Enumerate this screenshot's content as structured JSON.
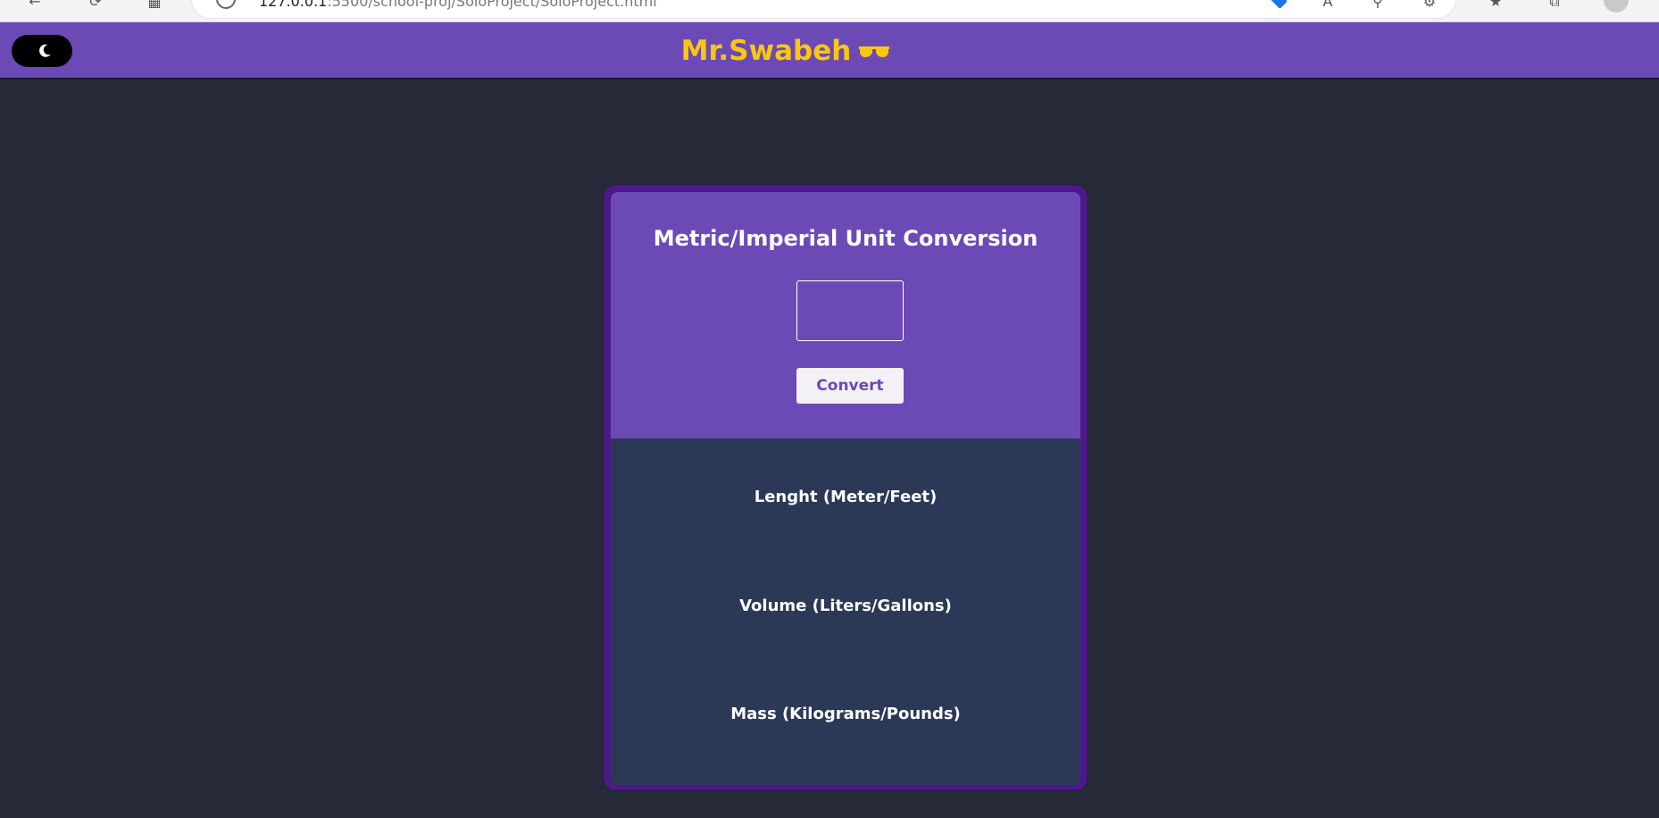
{
  "browser": {
    "address_host": "127.0.0.1",
    "address_rest": ":5500/school-proj/SoloProject/SoloProject.html"
  },
  "header": {
    "toggle_icon": "moon-icon",
    "brand_title": "Mr.Swabeh",
    "brand_icon": "sunglasses-icon",
    "background_color": "#6c4ab6",
    "brand_color": "#f9c70f"
  },
  "converter": {
    "title": "Metric/Imperial Unit Conversion",
    "input_value": "",
    "input_placeholder": "",
    "convert_label": "Convert",
    "results": {
      "length_label": "Lenght (Meter/Feet)",
      "volume_label": "Volume (Liters/Gallons)",
      "mass_label": "Mass (Kilograms/Pounds)"
    },
    "top_color": "#6c4ab6",
    "bottom_color": "#2b3957"
  }
}
